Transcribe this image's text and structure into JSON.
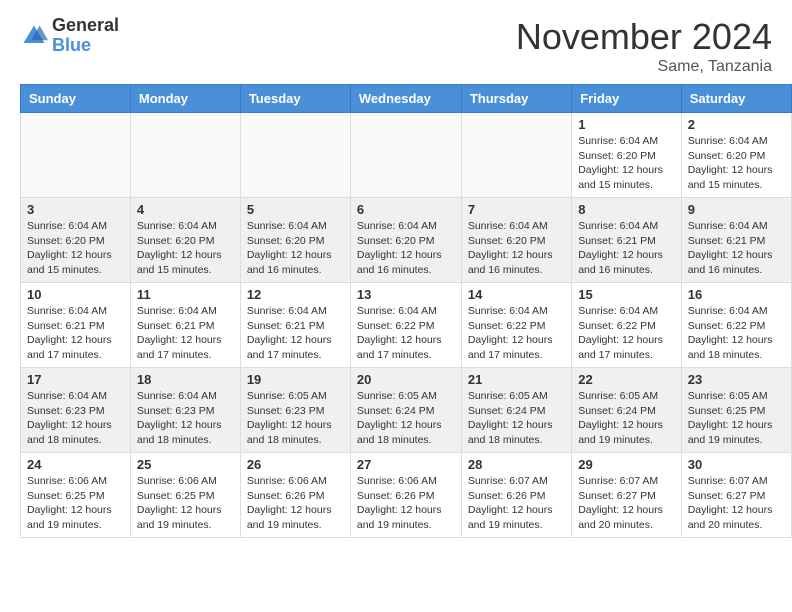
{
  "logo": {
    "general": "General",
    "blue": "Blue"
  },
  "title": "November 2024",
  "location": "Same, Tanzania",
  "headers": [
    "Sunday",
    "Monday",
    "Tuesday",
    "Wednesday",
    "Thursday",
    "Friday",
    "Saturday"
  ],
  "weeks": [
    [
      {
        "day": "",
        "info": ""
      },
      {
        "day": "",
        "info": ""
      },
      {
        "day": "",
        "info": ""
      },
      {
        "day": "",
        "info": ""
      },
      {
        "day": "",
        "info": ""
      },
      {
        "day": "1",
        "info": "Sunrise: 6:04 AM\nSunset: 6:20 PM\nDaylight: 12 hours and 15 minutes."
      },
      {
        "day": "2",
        "info": "Sunrise: 6:04 AM\nSunset: 6:20 PM\nDaylight: 12 hours and 15 minutes."
      }
    ],
    [
      {
        "day": "3",
        "info": "Sunrise: 6:04 AM\nSunset: 6:20 PM\nDaylight: 12 hours and 15 minutes."
      },
      {
        "day": "4",
        "info": "Sunrise: 6:04 AM\nSunset: 6:20 PM\nDaylight: 12 hours and 15 minutes."
      },
      {
        "day": "5",
        "info": "Sunrise: 6:04 AM\nSunset: 6:20 PM\nDaylight: 12 hours and 16 minutes."
      },
      {
        "day": "6",
        "info": "Sunrise: 6:04 AM\nSunset: 6:20 PM\nDaylight: 12 hours and 16 minutes."
      },
      {
        "day": "7",
        "info": "Sunrise: 6:04 AM\nSunset: 6:20 PM\nDaylight: 12 hours and 16 minutes."
      },
      {
        "day": "8",
        "info": "Sunrise: 6:04 AM\nSunset: 6:21 PM\nDaylight: 12 hours and 16 minutes."
      },
      {
        "day": "9",
        "info": "Sunrise: 6:04 AM\nSunset: 6:21 PM\nDaylight: 12 hours and 16 minutes."
      }
    ],
    [
      {
        "day": "10",
        "info": "Sunrise: 6:04 AM\nSunset: 6:21 PM\nDaylight: 12 hours and 17 minutes."
      },
      {
        "day": "11",
        "info": "Sunrise: 6:04 AM\nSunset: 6:21 PM\nDaylight: 12 hours and 17 minutes."
      },
      {
        "day": "12",
        "info": "Sunrise: 6:04 AM\nSunset: 6:21 PM\nDaylight: 12 hours and 17 minutes."
      },
      {
        "day": "13",
        "info": "Sunrise: 6:04 AM\nSunset: 6:22 PM\nDaylight: 12 hours and 17 minutes."
      },
      {
        "day": "14",
        "info": "Sunrise: 6:04 AM\nSunset: 6:22 PM\nDaylight: 12 hours and 17 minutes."
      },
      {
        "day": "15",
        "info": "Sunrise: 6:04 AM\nSunset: 6:22 PM\nDaylight: 12 hours and 17 minutes."
      },
      {
        "day": "16",
        "info": "Sunrise: 6:04 AM\nSunset: 6:22 PM\nDaylight: 12 hours and 18 minutes."
      }
    ],
    [
      {
        "day": "17",
        "info": "Sunrise: 6:04 AM\nSunset: 6:23 PM\nDaylight: 12 hours and 18 minutes."
      },
      {
        "day": "18",
        "info": "Sunrise: 6:04 AM\nSunset: 6:23 PM\nDaylight: 12 hours and 18 minutes."
      },
      {
        "day": "19",
        "info": "Sunrise: 6:05 AM\nSunset: 6:23 PM\nDaylight: 12 hours and 18 minutes."
      },
      {
        "day": "20",
        "info": "Sunrise: 6:05 AM\nSunset: 6:24 PM\nDaylight: 12 hours and 18 minutes."
      },
      {
        "day": "21",
        "info": "Sunrise: 6:05 AM\nSunset: 6:24 PM\nDaylight: 12 hours and 18 minutes."
      },
      {
        "day": "22",
        "info": "Sunrise: 6:05 AM\nSunset: 6:24 PM\nDaylight: 12 hours and 19 minutes."
      },
      {
        "day": "23",
        "info": "Sunrise: 6:05 AM\nSunset: 6:25 PM\nDaylight: 12 hours and 19 minutes."
      }
    ],
    [
      {
        "day": "24",
        "info": "Sunrise: 6:06 AM\nSunset: 6:25 PM\nDaylight: 12 hours and 19 minutes."
      },
      {
        "day": "25",
        "info": "Sunrise: 6:06 AM\nSunset: 6:25 PM\nDaylight: 12 hours and 19 minutes."
      },
      {
        "day": "26",
        "info": "Sunrise: 6:06 AM\nSunset: 6:26 PM\nDaylight: 12 hours and 19 minutes."
      },
      {
        "day": "27",
        "info": "Sunrise: 6:06 AM\nSunset: 6:26 PM\nDaylight: 12 hours and 19 minutes."
      },
      {
        "day": "28",
        "info": "Sunrise: 6:07 AM\nSunset: 6:26 PM\nDaylight: 12 hours and 19 minutes."
      },
      {
        "day": "29",
        "info": "Sunrise: 6:07 AM\nSunset: 6:27 PM\nDaylight: 12 hours and 20 minutes."
      },
      {
        "day": "30",
        "info": "Sunrise: 6:07 AM\nSunset: 6:27 PM\nDaylight: 12 hours and 20 minutes."
      }
    ]
  ]
}
